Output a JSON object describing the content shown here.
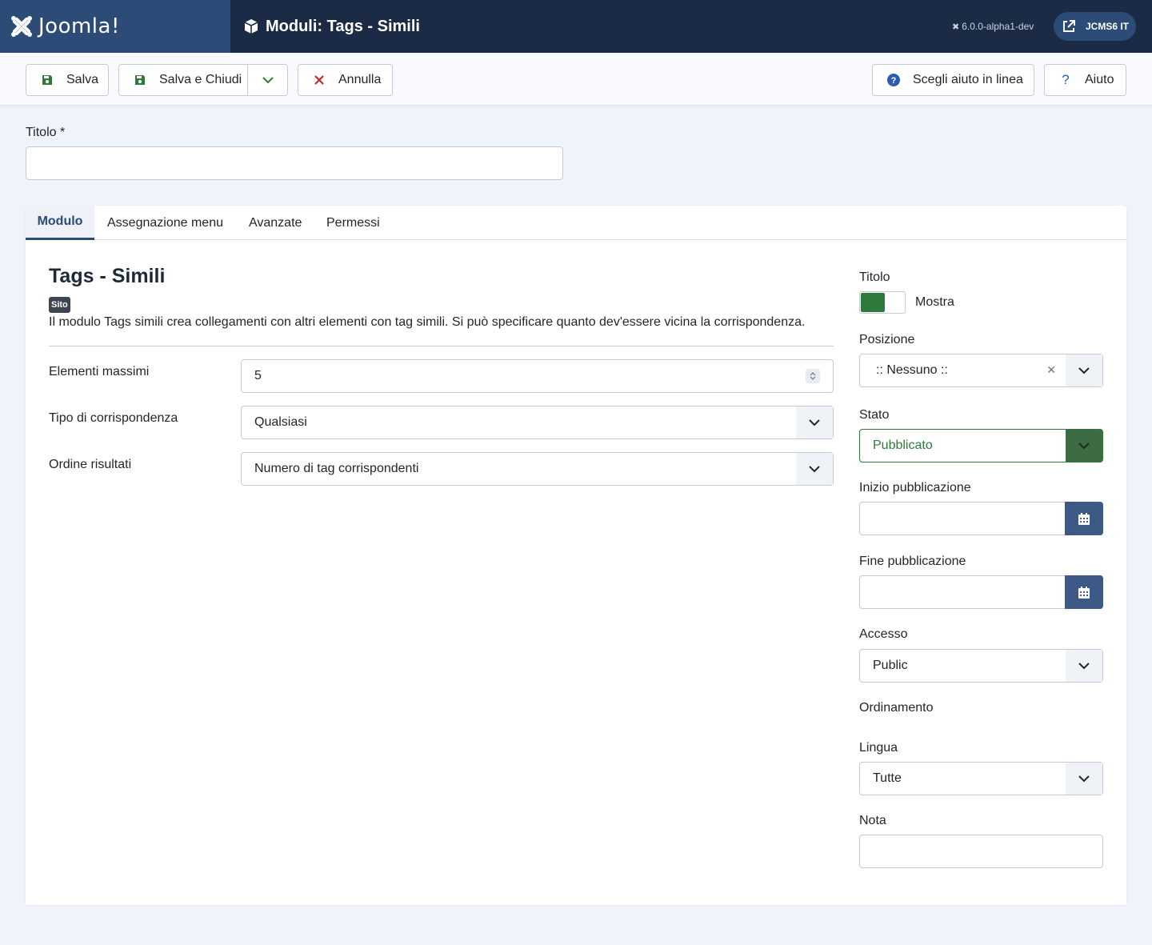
{
  "header": {
    "brand": "Joomla!",
    "title": "Moduli: Tags - Simili",
    "version": "6.0.0-alpha1-dev",
    "site_button": "JCMS6 IT"
  },
  "toolbar": {
    "save_label": "Salva",
    "save_close_label": "Salva e Chiudi",
    "cancel_label": "Annulla",
    "help_online_label": "Scegli aiuto in linea",
    "help_label": "Aiuto"
  },
  "form": {
    "title_label": "Titolo *",
    "title_value": ""
  },
  "tabs": [
    {
      "label": "Modulo"
    },
    {
      "label": "Assegnazione menu"
    },
    {
      "label": "Avanzate"
    },
    {
      "label": "Permessi"
    }
  ],
  "module": {
    "name": "Tags - Simili",
    "badge": "Sito",
    "description": "Il modulo Tags simili crea collegamenti con altri elementi con tag simili. Si può specificare quanto dev'essere vicina la corrispondenza."
  },
  "fields": {
    "max_items_label": "Elementi massimi",
    "max_items_value": "5",
    "match_type_label": "Tipo di corrispondenza",
    "match_type_value": "Qualsiasi",
    "order_label": "Ordine risultati",
    "order_value": "Numero di tag corrispondenti"
  },
  "sidebar": {
    "title_label": "Titolo",
    "title_toggle": "Mostra",
    "position_label": "Posizione",
    "position_value": ":: Nessuno ::",
    "status_label": "Stato",
    "status_value": "Pubblicato",
    "publish_up_label": "Inizio pubblicazione",
    "publish_down_label": "Fine pubblicazione",
    "access_label": "Accesso",
    "access_value": "Public",
    "ordering_label": "Ordinamento",
    "language_label": "Lingua",
    "language_value": "Tutte",
    "note_label": "Nota"
  },
  "colors": {
    "header_bg": "#1c2b45",
    "brand_bg": "#2c4b77",
    "published_green": "#2f7a3a",
    "calendar_blue": "#3d5a86",
    "cancel_red": "#c52827"
  }
}
